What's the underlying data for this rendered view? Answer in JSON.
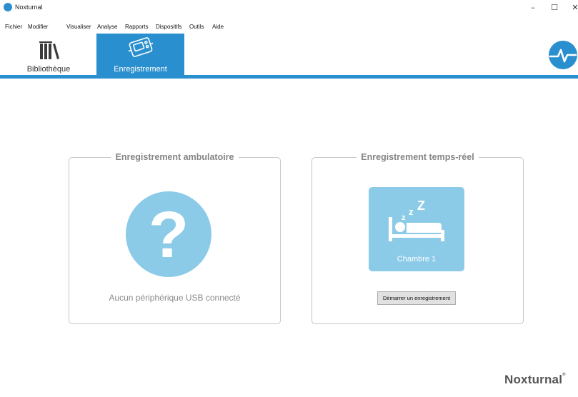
{
  "window": {
    "title": "Noxturnal",
    "controls": {
      "minimize": "–",
      "maximize": "☐",
      "close": "✕"
    }
  },
  "menu": {
    "items": [
      "Fichier",
      "Modifier",
      "Visualiser",
      "Analyse",
      "Rapports",
      "Dispositifs",
      "Outils",
      "Aide"
    ]
  },
  "tabs": {
    "library": {
      "label": "Bibliothèque",
      "icon": "books-icon"
    },
    "recording": {
      "label": "Enregistrement",
      "icon": "recording-device-icon",
      "active": true
    }
  },
  "ambulatory": {
    "title": "Enregistrement ambulatoire",
    "icon": "question-mark-icon",
    "status": "Aucun périphérique USB connecté"
  },
  "realtime": {
    "title": "Enregistrement temps-réel",
    "room": {
      "label": "Chambre 1",
      "icon": "sleeping-bed-icon"
    },
    "start_button": "Démarrer un enregistrement"
  },
  "brand": {
    "name": "Noxturnal",
    "mark": "®"
  },
  "colors": {
    "accent": "#2a8fce",
    "tile": "#8ccbe8",
    "panel_title": "#858585"
  }
}
